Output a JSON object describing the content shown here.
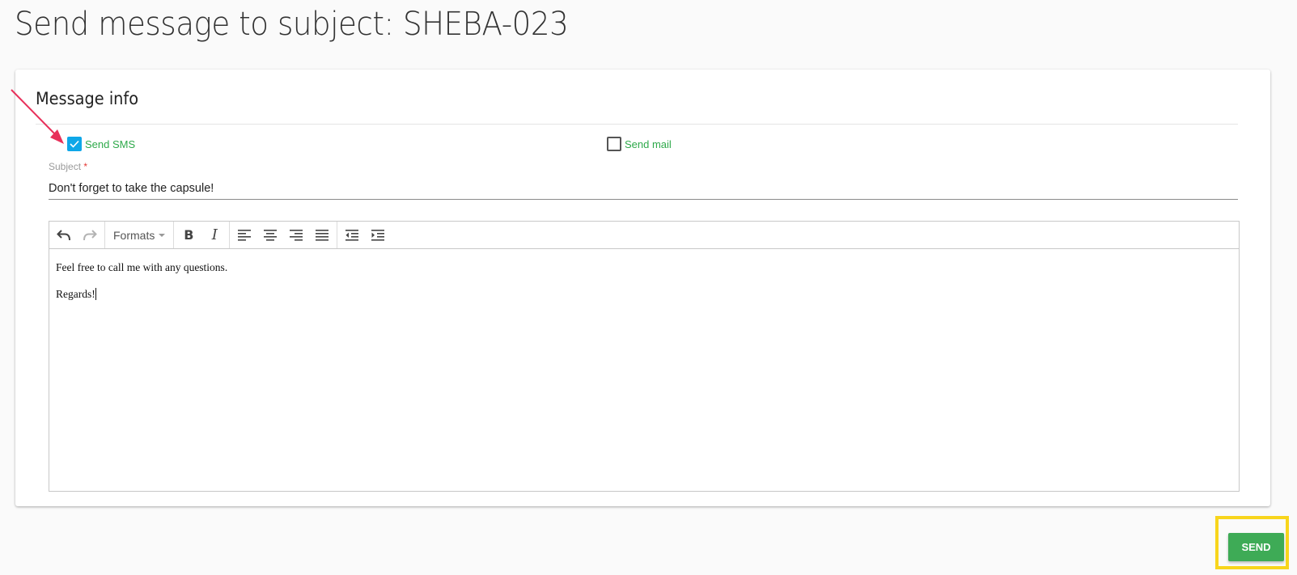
{
  "page": {
    "title": "Send message to subject: SHEBA-023"
  },
  "card": {
    "title": "Message info"
  },
  "options": {
    "send_sms": {
      "label": "Send SMS",
      "checked": true
    },
    "send_mail": {
      "label": "Send mail",
      "checked": false
    }
  },
  "subject": {
    "label": "Subject",
    "required_mark": "*",
    "value": "Don't forget to take the capsule!"
  },
  "editor": {
    "toolbar": {
      "undo_icon": "undo-icon",
      "redo_icon": "redo-icon",
      "formats_label": "Formats",
      "bold_glyph": "B",
      "italic_glyph": "I"
    },
    "body": {
      "line1": "Feel free to call me with any questions.",
      "line2": "Regards!"
    }
  },
  "actions": {
    "send_label": "SEND"
  },
  "colors": {
    "accent_green": "#3eab56",
    "checkbox_blue": "#0ea7e8",
    "label_green": "#2ea94a",
    "annotation_arrow": "#e8305a",
    "annotation_highlight": "#f8d51c"
  }
}
